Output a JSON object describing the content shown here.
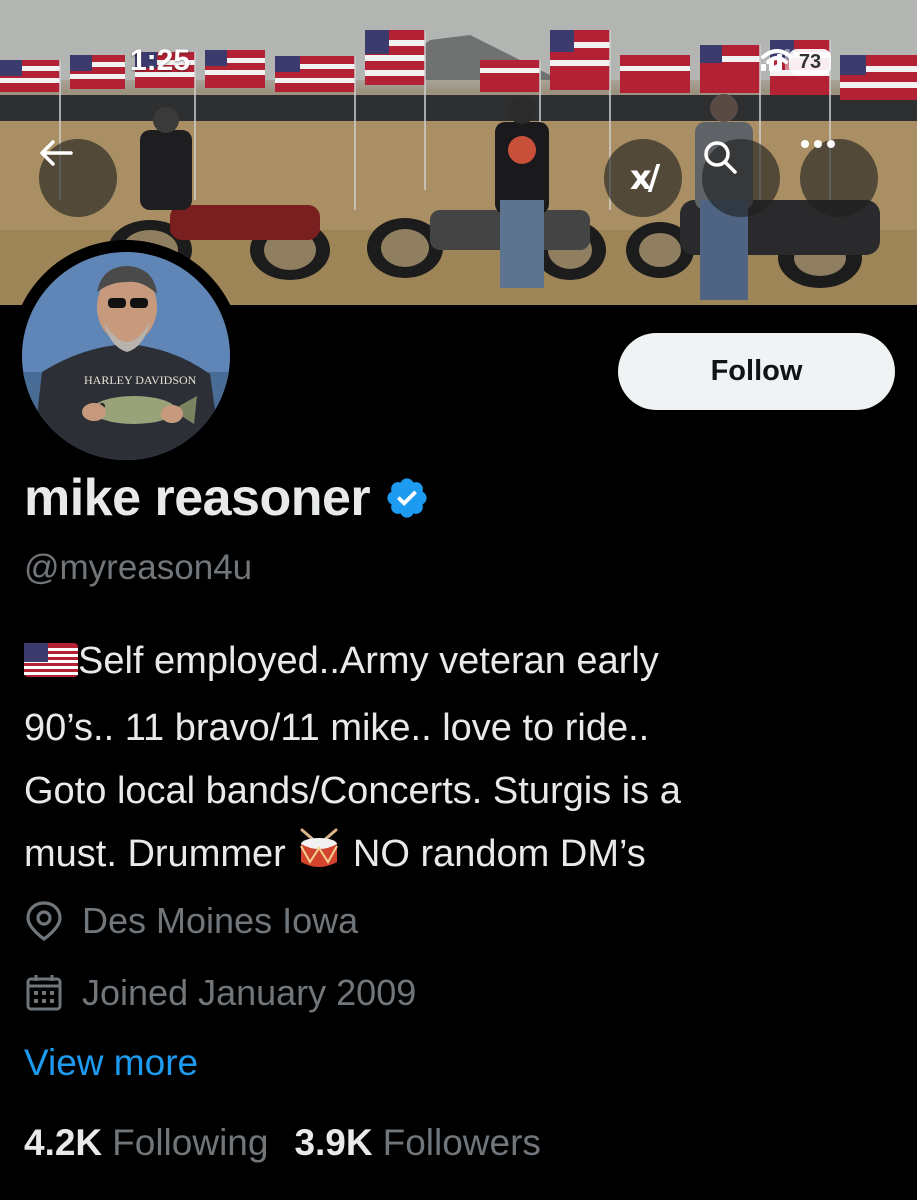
{
  "status_bar": {
    "time": "1:25",
    "battery": "73"
  },
  "banner": {
    "description_icon": "banner-photo"
  },
  "header": {
    "back_icon": "arrow-left-icon",
    "grok_icon_text": "x/",
    "search_icon": "search-icon",
    "more_icon": "more-icon"
  },
  "profile": {
    "display_name": "mike reasoner",
    "handle": "@myreason4u",
    "follow_label": "Follow",
    "bio": {
      "line1": "Self employed..Army veteran early",
      "line2": "90’s.. 11 bravo/11 mike.. love to ride..",
      "line3": "Goto local bands/Concerts. Sturgis is a",
      "line4a": "must. Drummer",
      "line4b": "NO random DM’s"
    },
    "location": "Des Moines Iowa",
    "joined": "Joined January 2009",
    "view_more": "View more",
    "following_count": "4.2K",
    "following_label": "Following",
    "followers_count": "3.9K",
    "followers_label": "Followers"
  },
  "colors": {
    "background": "#000000",
    "text": "#e7e9ea",
    "muted": "#71767b",
    "link": "#1d9bf0",
    "verified": "#1d9bf0",
    "follow_bg": "#eff3f4"
  }
}
